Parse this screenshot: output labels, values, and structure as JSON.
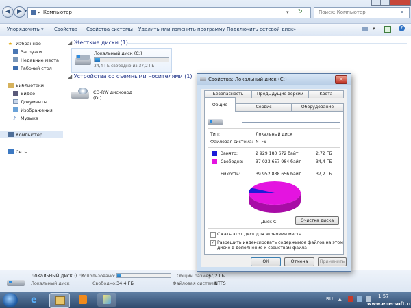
{
  "address": {
    "path_label": "Компьютер",
    "search_placeholder": "Поиск: Компьютер"
  },
  "toolbar": {
    "items": [
      "Упорядочить ▾",
      "Свойства",
      "Свойства системы",
      "Удалить или изменить программу",
      "Подключить сетевой диск",
      "»"
    ]
  },
  "nav": {
    "favorites": "Избранное",
    "downloads": "Загрузки",
    "recent": "Недавние места",
    "desktop": "Рабочий стол",
    "libraries": "Библиотеки",
    "video": "Видео",
    "documents": "Документы",
    "images": "Изображения",
    "music": "Музыка",
    "computer": "Компьютер",
    "network": "Сеть"
  },
  "content": {
    "hdd_group": "Жесткие диски (1)",
    "local_disk_name": "Локальный диск (C:)",
    "local_disk_free": "34,4 ГБ свободно из 37,2 ГБ",
    "local_disk_used_fraction": 0.07,
    "removable_group": "Устройства со съемными носителями (1)",
    "cdrom_name": "CD-RW дисковод (D:)"
  },
  "details": {
    "title": "Локальный диск (C:)",
    "subtitle": "Локальный диск",
    "used_label": "Использовано:",
    "free_label": "Свободно:",
    "free_value": "34,4 ГБ",
    "total_label": "Общий размер:",
    "total_value": "37,2 ГБ",
    "fs_label": "Файловая система:",
    "fs_value": "NTFS"
  },
  "dialog": {
    "title": "Свойства: Локальный диск (C:)",
    "tabs_row1": [
      "Безопасность",
      "Предыдущие версии",
      "Квота"
    ],
    "tabs_row2": [
      "Общие",
      "Сервис",
      "Оборудование"
    ],
    "type_label": "Тип:",
    "type_value": "Локальный диск",
    "fs_label": "Файловая система:",
    "fs_value": "NTFS",
    "used_label": "Занято:",
    "used_bytes": "2 929 180 672 байт",
    "used_size": "2,72 ГБ",
    "free_label": "Свободно:",
    "free_bytes": "37 023 657 984 байт",
    "free_size": "34,4 ГБ",
    "capacity_label": "Емкость:",
    "capacity_bytes": "39 952 838 656 байт",
    "capacity_size": "37,2 ГБ",
    "disk_label": "Диск C:",
    "cleanup_button": "Очистка диска",
    "compress_label": "Сжать этот диск для экономии места",
    "index_label_1": "Разрешить индексировать содержимое файлов на этом",
    "index_label_2": "диске в дополнение к свойствам файла",
    "ok": "ОК",
    "cancel": "Отмена",
    "apply": "Применить",
    "used_color": "#1c1cd8",
    "free_color": "#e414e0",
    "used_fraction": 0.0733
  },
  "taskbar": {
    "lang": "RU",
    "time": "1:57",
    "watermark": "www.enersoft.ru"
  }
}
